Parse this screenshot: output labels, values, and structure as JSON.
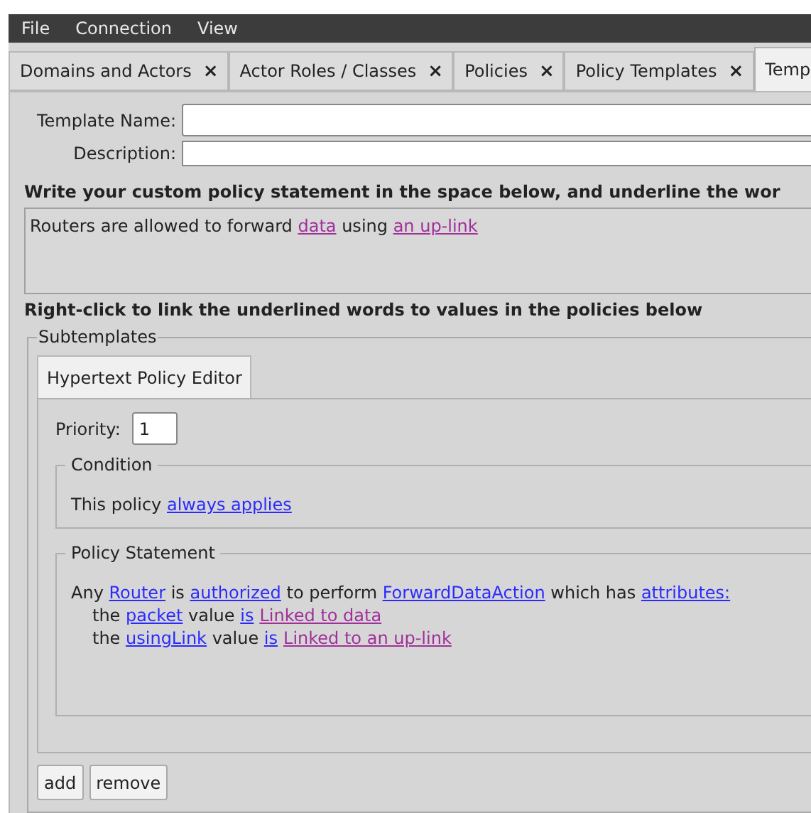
{
  "menu": [
    {
      "label": "File"
    },
    {
      "label": "Connection"
    },
    {
      "label": "View"
    }
  ],
  "tabs": [
    {
      "label": "Domains and Actors",
      "close": "×",
      "selected": false
    },
    {
      "label": "Actor Roles / Classes",
      "close": "×",
      "selected": false
    },
    {
      "label": "Policies",
      "close": "×",
      "selected": false
    },
    {
      "label": "Policy Templates",
      "close": "×",
      "selected": false
    },
    {
      "label": "Temp",
      "selected": true
    }
  ],
  "fields": [
    {
      "label": "Template Name:"
    },
    {
      "label": "Description:"
    }
  ],
  "instruction": "Write your custom policy statement in the space below, and underline the wor",
  "statement": [
    {
      "kind": "text",
      "text": "Routers are allowed to forward "
    },
    {
      "kind": "linked",
      "text": "data"
    },
    {
      "kind": "text",
      "text": " using "
    },
    {
      "kind": "linked",
      "text": "an up-link"
    }
  ],
  "hint": "Right-click to link the underlined words to values in the policies below",
  "subtemplates": {
    "title": "Subtemplates",
    "tabs": [
      {
        "label": "Hypertext Policy Editor",
        "selected": true
      }
    ],
    "priority": {
      "label": "Priority:",
      "value": "1"
    },
    "sections": [
      {
        "title": "Condition",
        "lines": [
          [
            {
              "kind": "text",
              "text": "This policy "
            },
            {
              "kind": "link",
              "text": "always applies"
            }
          ]
        ]
      },
      {
        "title": "Policy Statement",
        "lines": [
          [
            {
              "kind": "text",
              "text": "Any "
            },
            {
              "kind": "link",
              "text": "Router"
            },
            {
              "kind": "text",
              "text": " is "
            },
            {
              "kind": "link",
              "text": "authorized"
            },
            {
              "kind": "text",
              "text": " to perform "
            },
            {
              "kind": "link",
              "text": "ForwardDataAction"
            },
            {
              "kind": "text",
              "text": " which has "
            },
            {
              "kind": "link",
              "text": "attributes:"
            }
          ],
          [
            {
              "kind": "text",
              "text": "the "
            },
            {
              "kind": "link",
              "text": "packet"
            },
            {
              "kind": "text",
              "text": " value "
            },
            {
              "kind": "link",
              "text": "is"
            },
            {
              "kind": "linked",
              "text": "Linked to data",
              "space_before": true
            }
          ],
          [
            {
              "kind": "text",
              "text": "the "
            },
            {
              "kind": "link",
              "text": "usingLink"
            },
            {
              "kind": "text",
              "text": " value "
            },
            {
              "kind": "link",
              "text": "is"
            },
            {
              "kind": "linked",
              "text": "Linked to an up-link",
              "space_before": true
            }
          ]
        ]
      }
    ]
  },
  "buttons": [
    {
      "label": "add"
    },
    {
      "label": "remove"
    }
  ]
}
